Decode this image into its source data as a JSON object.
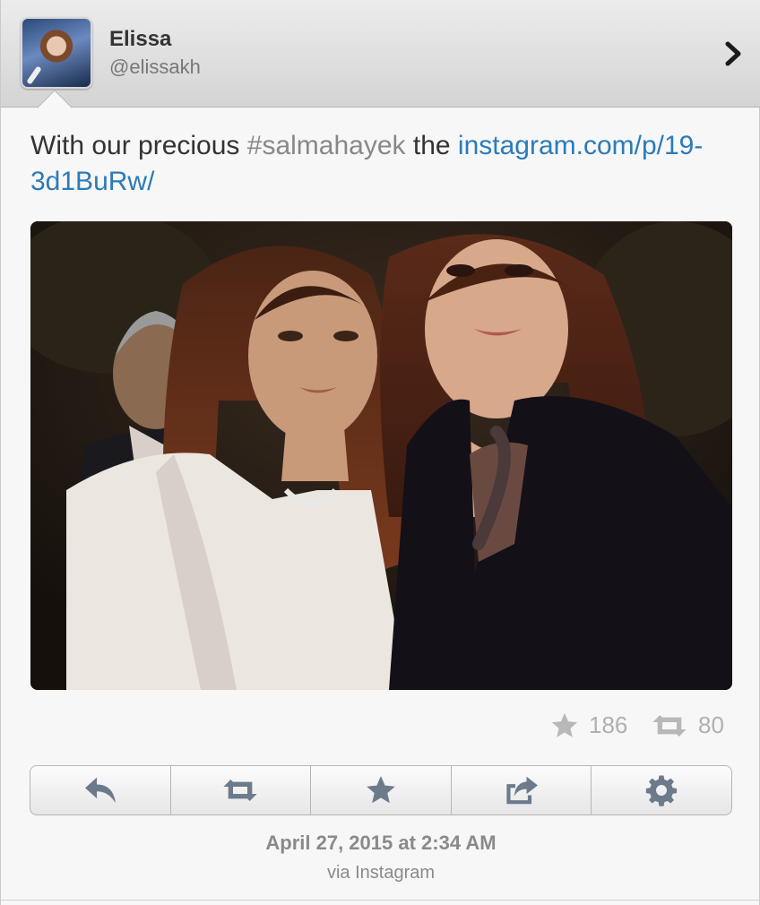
{
  "user": {
    "display_name": "Elissa",
    "handle": "@elissakh"
  },
  "tweet": {
    "text_before": "With our precious ",
    "hashtag": "#salmahayek",
    "text_middle": " the ",
    "link": "instagram.com/p/19-3d1BuRw/"
  },
  "stats": {
    "favorites": "186",
    "retweets": "80"
  },
  "actions": [
    {
      "icon": "reply-icon"
    },
    {
      "icon": "retweet-icon"
    },
    {
      "icon": "favorite-star-icon"
    },
    {
      "icon": "share-icon"
    },
    {
      "icon": "gear-icon"
    }
  ],
  "footer": {
    "timestamp": "April 27, 2015 at 2:34 AM",
    "via": "via Instagram"
  },
  "colors": {
    "link": "#2b7bb9",
    "hashtag": "#888888",
    "icon": "#6b7b8c",
    "stat_icon": "#b8b8b8"
  }
}
